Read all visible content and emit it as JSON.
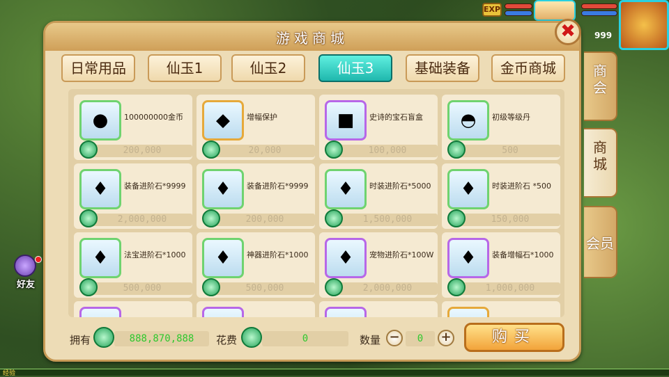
{
  "hud": {
    "exp_badge": "EXP",
    "level_text": "999",
    "friend_label": "好友",
    "exp_bar_label": "经验"
  },
  "shop": {
    "title": "游戏商城",
    "tabs": [
      {
        "label": "日常用品"
      },
      {
        "label": "仙玉1"
      },
      {
        "label": "仙玉2"
      },
      {
        "label": "仙玉3"
      },
      {
        "label": "基础装备"
      },
      {
        "label": "金币商城"
      }
    ],
    "active_tab": "仙玉3",
    "side_tabs": [
      {
        "label": "商会"
      },
      {
        "label": "商城"
      },
      {
        "label": "会员"
      }
    ],
    "active_side_tab": "商城",
    "items": [
      {
        "name": "100000000金币",
        "price": "200,000",
        "icon": "gold-coin-icon",
        "frame": "green"
      },
      {
        "name": "增幅保护",
        "price": "20,000",
        "icon": "shield-charm-icon",
        "frame": "gold"
      },
      {
        "name": "史诗的宝石盲盒",
        "price": "100,000",
        "icon": "treasure-chest-icon",
        "frame": "purple"
      },
      {
        "name": "初级等级丹",
        "price": "500",
        "icon": "pill-plate-icon",
        "frame": "green"
      },
      {
        "name": "装备进阶石*9999",
        "price": "2,000,000",
        "icon": "stone-bag-icon",
        "frame": "green"
      },
      {
        "name": "装备进阶石*9999",
        "price": "200,000",
        "icon": "stone-bag-icon",
        "frame": "green"
      },
      {
        "name": "时装进阶石*5000",
        "price": "1,500,000",
        "icon": "stone-bag-icon",
        "frame": "green"
      },
      {
        "name": "时装进阶石 *500",
        "price": "150,000",
        "icon": "stone-bag-icon",
        "frame": "green"
      },
      {
        "name": "法宝进阶石*1000",
        "price": "500,000",
        "icon": "stone-bag-icon",
        "frame": "green"
      },
      {
        "name": "神器进阶石*1000",
        "price": "500,000",
        "icon": "stone-bag-icon",
        "frame": "green"
      },
      {
        "name": "宠物进阶石*100W",
        "price": "2,000,000",
        "icon": "stone-bag-icon",
        "frame": "purple"
      },
      {
        "name": "装备增幅石*1000",
        "price": "1,000,000",
        "icon": "stone-bag-icon",
        "frame": "purple"
      },
      {
        "name": "",
        "price": "",
        "icon": "item-icon",
        "frame": "purple"
      },
      {
        "name": "",
        "price": "",
        "icon": "item-icon",
        "frame": "purple"
      },
      {
        "name": "",
        "price": "",
        "icon": "item-icon",
        "frame": "purple"
      },
      {
        "name": "",
        "price": "",
        "icon": "item-icon",
        "frame": "gold"
      }
    ],
    "footer": {
      "own_label": "拥有",
      "own_value": "888,870,888",
      "cost_label": "花费",
      "cost_value": "0",
      "qty_label": "数量",
      "qty_value": "0",
      "minus": "−",
      "plus": "+",
      "buy_label": "购买"
    },
    "close_symbol": "✖"
  },
  "colors": {
    "accent_active_tab": "#1fb7ad",
    "price_text": "#c3b28f",
    "currency_green": "#2ec82e"
  }
}
